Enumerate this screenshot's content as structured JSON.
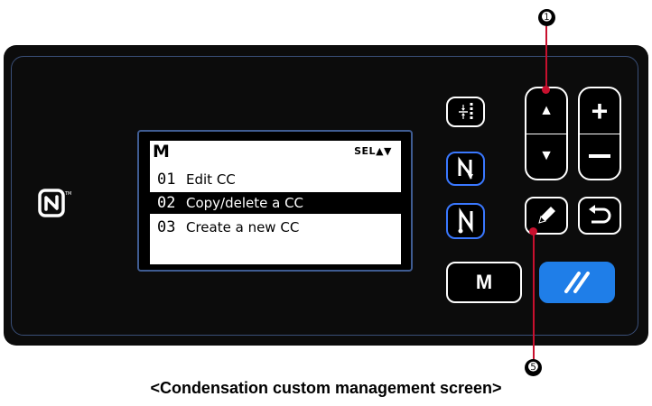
{
  "screen": {
    "title": "M",
    "sel_indicator": "SEL▲▼",
    "items": [
      {
        "num": "01",
        "label": "Edit CC",
        "selected": false
      },
      {
        "num": "02",
        "label": "Copy/delete a CC",
        "selected": true
      },
      {
        "num": "03",
        "label": "Create a new CC",
        "selected": false
      }
    ]
  },
  "buttons": {
    "m_label": "M",
    "up_symbol": "▲",
    "down_symbol": "▼",
    "plus_symbol": "+",
    "minus_symbol": "—"
  },
  "callouts": {
    "top": "➊",
    "bottom": "➎"
  },
  "caption": "<Condensation custom management screen>",
  "colors": {
    "panel": "#0c0c0c",
    "accent_blue": "#1f7ee8",
    "callout_red": "#c8102e",
    "lcd_border": "#3f5c92"
  }
}
